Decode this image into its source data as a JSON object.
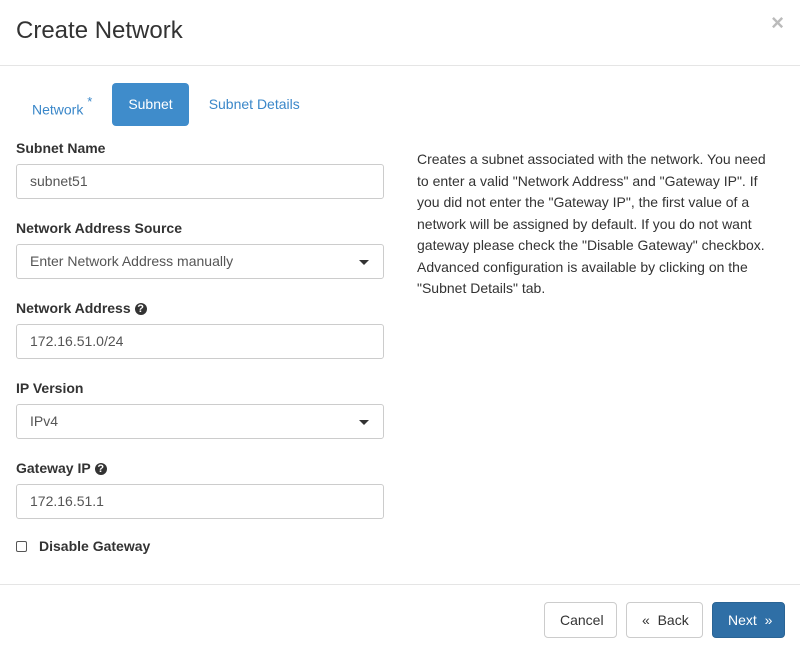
{
  "dialog": {
    "title": "Create Network",
    "close_icon": "×"
  },
  "tabs": [
    {
      "label": "Network",
      "required": "*"
    },
    {
      "label": "Subnet"
    },
    {
      "label": "Subnet Details"
    }
  ],
  "form": {
    "subnet_name": {
      "label": "Subnet Name",
      "value": "subnet51"
    },
    "address_source": {
      "label": "Network Address Source",
      "value": "Enter Network Address manually"
    },
    "network_address": {
      "label": "Network Address",
      "value": "172.16.51.0/24"
    },
    "ip_version": {
      "label": "IP Version",
      "value": "IPv4"
    },
    "gateway_ip": {
      "label": "Gateway IP",
      "value": "172.16.51.1"
    },
    "disable_gateway": {
      "label": "Disable Gateway",
      "checked": false
    }
  },
  "description": "Creates a subnet associated with the network. You need to enter a valid \"Network Address\" and \"Gateway IP\". If you did not enter the \"Gateway IP\", the first value of a network will be assigned by default. If you do not want gateway please check the \"Disable Gateway\" checkbox. Advanced configuration is available by clicking on the \"Subnet Details\" tab.",
  "footer": {
    "cancel": "Cancel",
    "back": "«  Back",
    "next": "Next  »"
  }
}
